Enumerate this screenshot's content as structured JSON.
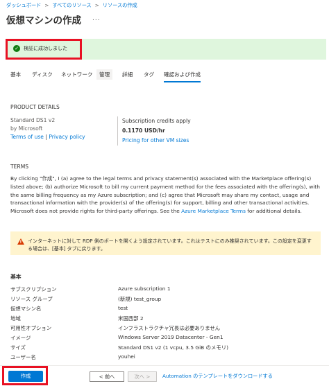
{
  "breadcrumb": {
    "items": [
      "ダッシュボード",
      "すべてのリソース",
      "リソースの作成"
    ],
    "separator": ">"
  },
  "page": {
    "title": "仮想マシンの作成",
    "more": "..."
  },
  "validation": {
    "message": "検証に成功しました",
    "status_color": "#107c10",
    "icon": "checkmark-circle-icon"
  },
  "tabs": [
    {
      "label": "基本"
    },
    {
      "label": "ディスク"
    },
    {
      "label": "ネットワーク"
    },
    {
      "label": "管理"
    },
    {
      "label": "詳細"
    },
    {
      "label": "タグ"
    },
    {
      "label": "確認および作成"
    }
  ],
  "product": {
    "heading": "PRODUCT DETAILS",
    "name": "Standard DS1 v2",
    "publisher": "by Microsoft",
    "terms_link": "Terms of use",
    "divider": "|",
    "privacy_link": "Privacy policy",
    "credits_label": "Subscription credits apply",
    "price": "0.1170 USD/hr",
    "pricing_link": "Pricing for other VM sizes"
  },
  "terms": {
    "heading": "TERMS",
    "body": "By clicking \"作成\", I (a) agree to the legal terms and privacy statement(s) associated with the Marketplace offering(s) listed above; (b) authorize Microsoft to bill my current payment method for the fees associated with the offering(s), with the same billing frequency as my Azure subscription; and (c) agree that Microsoft may share my contact, usage and transactional information with the provider(s) of the offering(s) for support, billing and other transactional activities. Microsoft does not provide rights for third-party offerings. See the ",
    "marketplace_link": "Azure Marketplace Terms",
    "body_end": " for additional details."
  },
  "warning": {
    "icon": "warning-icon",
    "text": "インターネットに対して RDP 側のポートを開くよう設定されています。これはテストにのみ推奨されています。この設定を変更する場合は、[基本] タブに戻ります。"
  },
  "basics": {
    "heading": "基本",
    "rows": [
      {
        "key": "サブスクリプション",
        "value": "Azure subscription 1"
      },
      {
        "key": "リソース グループ",
        "value": "(新規) test_group"
      },
      {
        "key": "仮想マシン名",
        "value": "test"
      },
      {
        "key": "地域",
        "value": "米国西部 2"
      },
      {
        "key": "可用性オプション",
        "value": "インフラストラクチャ冗長は必要ありません"
      },
      {
        "key": "イメージ",
        "value": "Windows Server 2019 Datacenter - Gen1"
      },
      {
        "key": "サイズ",
        "value": "Standard DS1 v2 (1 vcpu, 3.5 GiB のメモリ)"
      },
      {
        "key": "ユーザー名",
        "value": "youhei"
      }
    ]
  },
  "footer": {
    "create": "作成",
    "prev": "< 前へ",
    "next": "次へ >",
    "template_link": "Automation のテンプレートをダウンロードする"
  },
  "colors": {
    "accent": "#0078d4",
    "success_bg": "#dff6dd",
    "warning_bg": "#fff4ce",
    "highlight": "#e81123"
  }
}
